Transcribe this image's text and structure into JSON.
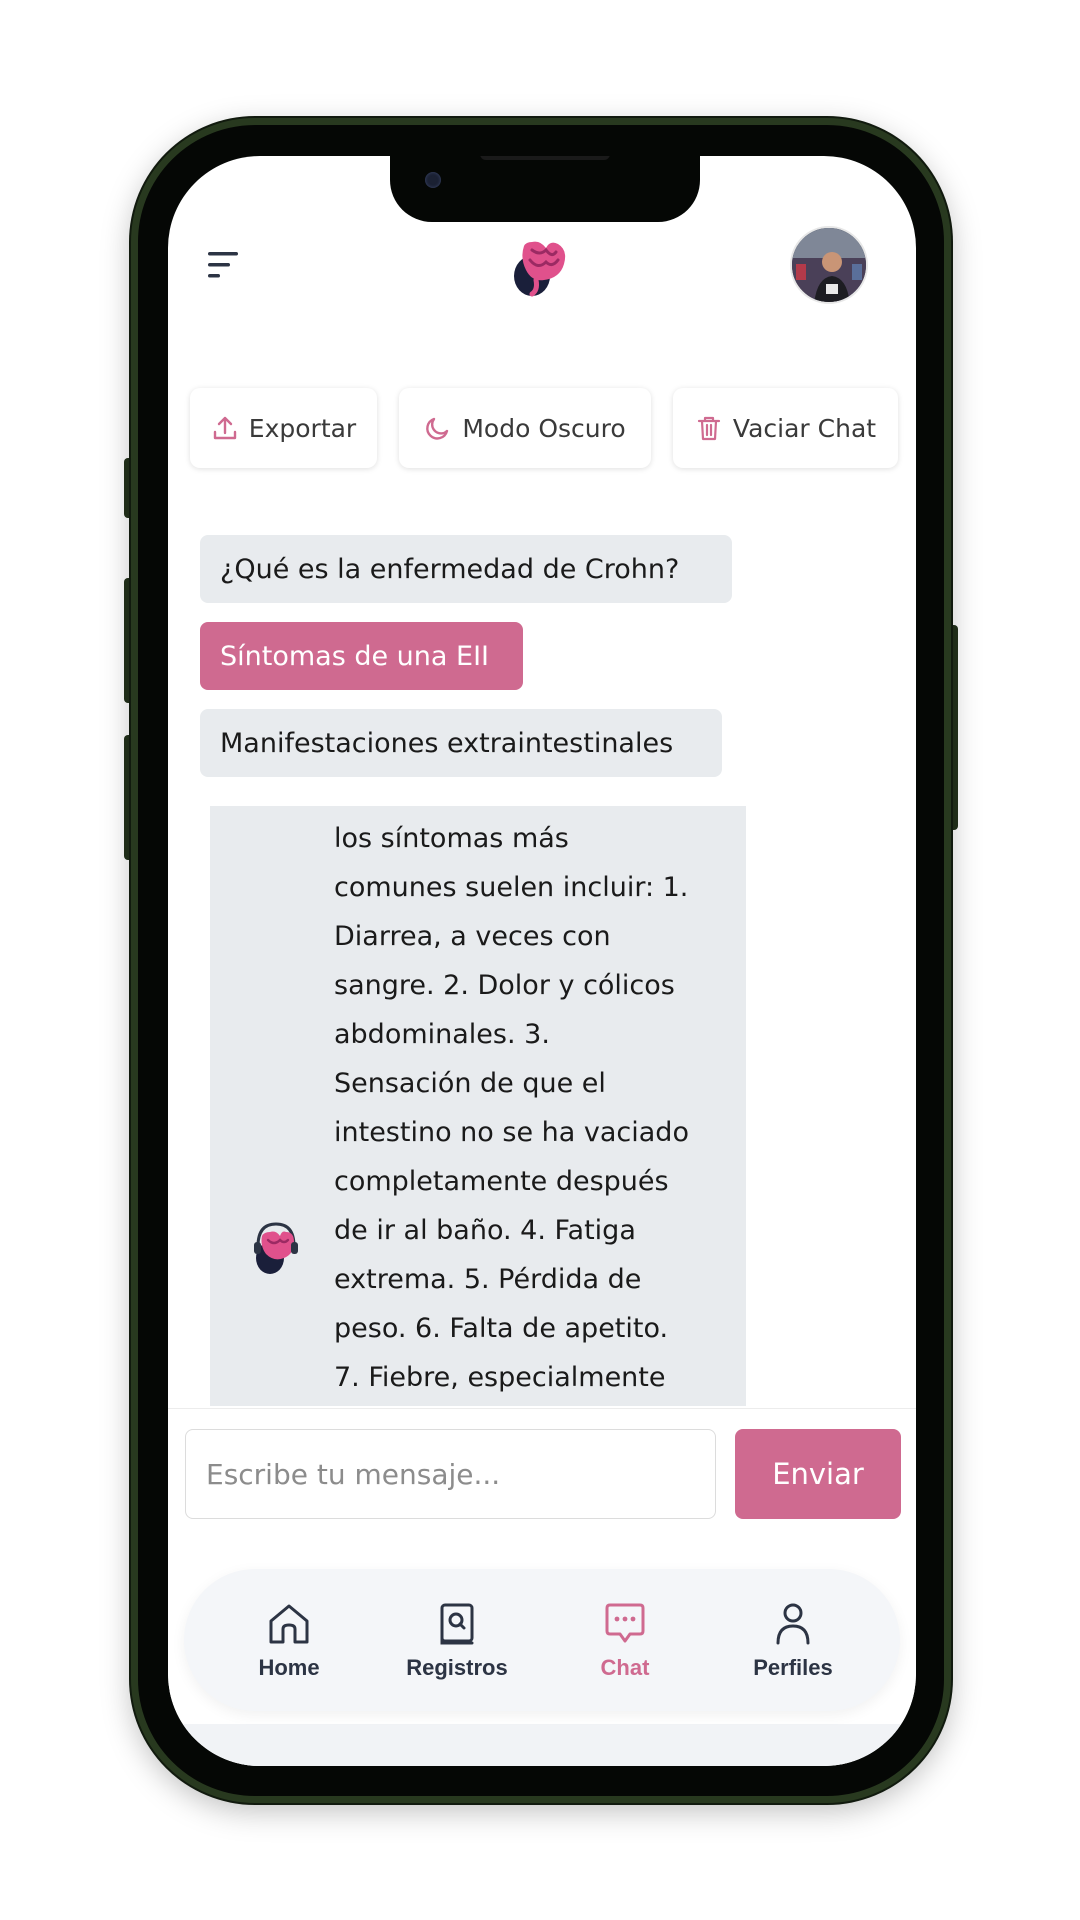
{
  "header": {
    "menu_icon": "menu-lines-icon",
    "logo_icon": "intestine-logo-icon",
    "avatar": "user-avatar"
  },
  "actions": [
    {
      "label": "Exportar",
      "icon": "upload-icon"
    },
    {
      "label": "Modo Oscuro",
      "icon": "moon-icon"
    },
    {
      "label": "Vaciar Chat",
      "icon": "trash-icon"
    }
  ],
  "suggestions": [
    {
      "label": "¿Qué es la enfermedad de Crohn?"
    },
    {
      "label": "Síntomas de una EII"
    },
    {
      "label": "Manifestaciones extraintestinales"
    }
  ],
  "bot_message": {
    "lines": [
      "los síntomas más",
      "comunes suelen incluir: 1.",
      "Diarrea, a veces con",
      "sangre. 2. Dolor y cólicos",
      "abdominales. 3.",
      "Sensación de que el",
      "intestino no se ha vaciado",
      "completamente después",
      "de ir al baño. 4. Fatiga",
      "extrema. 5. Pérdida de",
      "peso. 6. Falta de apetito.",
      "7. Fiebre, especialmente"
    ]
  },
  "input": {
    "placeholder": "Escribe tu mensaje...",
    "value": "",
    "send_label": "Enviar"
  },
  "nav": {
    "items": [
      {
        "label": "Home",
        "icon": "home-icon"
      },
      {
        "label": "Registros",
        "icon": "records-book-icon"
      },
      {
        "label": "Chat",
        "icon": "chat-bubble-icon",
        "active": true
      },
      {
        "label": "Perfiles",
        "icon": "user-icon"
      }
    ]
  },
  "colors": {
    "accent": "#cf6a90",
    "chip_gray": "#e8ebee",
    "nav_text": "#2c3444"
  }
}
